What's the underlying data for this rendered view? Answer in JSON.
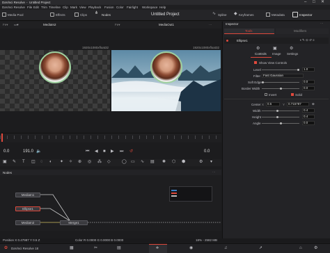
{
  "title_bar": {
    "app": "DaVinci Resolve",
    "separator": "-",
    "project": "Untitled Project"
  },
  "menu": [
    "DaVinci Resolve",
    "File",
    "Edit",
    "Trim",
    "Timeline",
    "Clip",
    "Mark",
    "View",
    "Playback",
    "Fusion",
    "Color",
    "Fairlight",
    "Workspace",
    "Help"
  ],
  "toolbar": {
    "media_pool": "Media Pool",
    "effects": "Effects",
    "clips": "Clips",
    "nodes": "Nodes",
    "project_title": "Untitled Project",
    "spline": "Spline",
    "keyframes": "Keyframes",
    "metadata": "Metadata",
    "inspector": "Inspector"
  },
  "viewer_left": {
    "node": "MediaIn2",
    "resolution": "1920x1080xfloat32"
  },
  "viewer_right": {
    "node": "MediaOut1",
    "resolution": "1920x1080xfloat32"
  },
  "transport": {
    "start": "0.0",
    "end": "191.0",
    "current": "0.0"
  },
  "inspector": {
    "title": "Inspector",
    "tabs": [
      "Tools",
      "Modifiers"
    ],
    "node_name": "Ellipse1",
    "subtabs": [
      "Controls",
      "Image",
      "Settings"
    ],
    "show_view_controls": "Show View Controls",
    "fields": {
      "level_label": "Level",
      "level": "1.0",
      "filter_label": "Filter",
      "filter": "Fast Gaussian",
      "soft_edge_label": "Soft Edge",
      "soft_edge": "0.0",
      "border_width_label": "Border Width",
      "border_width": "0.0",
      "invert": "Invert",
      "solid": "Solid",
      "center_label": "Center",
      "center_x": "0.5",
      "center_y": "0.715787",
      "width_label": "Width",
      "width": "0.4",
      "height_label": "Height",
      "height": "0.4",
      "angle_label": "Angle",
      "angle": "0.0"
    }
  },
  "nodes_panel": {
    "title": "Nodes",
    "nodes": [
      "MediaIn1",
      "Ellipse1",
      "MediaIn2",
      "Merge1"
    ]
  },
  "status": {
    "position": "Position X 0.47987  Y 0.5  Z",
    "color": "Color R 0.0000 G 0.0000 B 0.0000",
    "usage": "18% - 2582 MB"
  },
  "bottom": {
    "app_label": "DaVinci Resolve 18"
  },
  "colors": {
    "accent": "#e0493c",
    "inspector_tab_active": "#e0493c",
    "sky_top": "#4a7c99",
    "fog": "#dfe8ee"
  }
}
